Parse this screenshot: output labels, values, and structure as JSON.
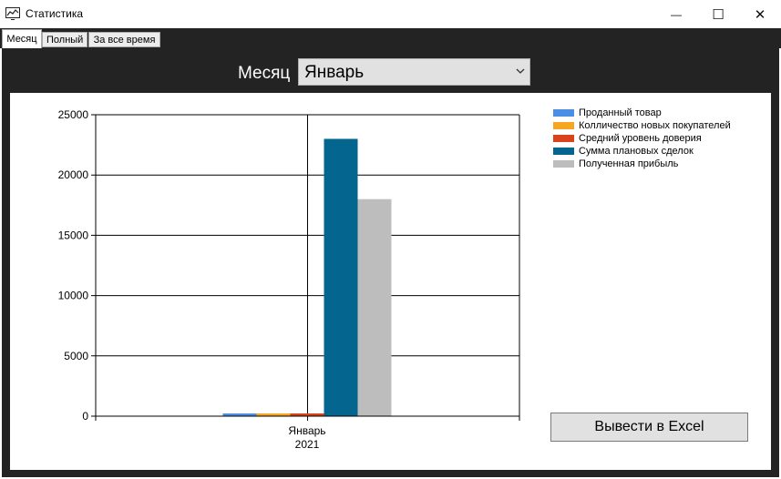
{
  "window": {
    "title": "Статистика",
    "minimize_glyph": "—",
    "maximize_glyph": "☐",
    "close_glyph": "✕"
  },
  "tabs": [
    {
      "label": "Месяц",
      "active": true
    },
    {
      "label": "Полный",
      "active": false
    },
    {
      "label": "За все время",
      "active": false
    }
  ],
  "filter": {
    "label": "Месяц",
    "selected": "Январь"
  },
  "export_button": "Вывести в Excel",
  "colors": {
    "panel_bg": "#232323",
    "series": [
      "#4a8fe5",
      "#f5a623",
      "#d9421a",
      "#04668f",
      "#bdbdbd"
    ]
  },
  "chart_data": {
    "type": "bar",
    "categories": [
      "Январь\n2021"
    ],
    "series": [
      {
        "name": "Проданный товар",
        "values": [
          150
        ],
        "color": "#4a8fe5"
      },
      {
        "name": "Колличество новых покупателей",
        "values": [
          150
        ],
        "color": "#f5a623"
      },
      {
        "name": "Средний уровень доверия",
        "values": [
          150
        ],
        "color": "#d9421a"
      },
      {
        "name": "Сумма плановых сделок",
        "values": [
          23000
        ],
        "color": "#04668f"
      },
      {
        "name": "Полученная прибыль",
        "values": [
          18000
        ],
        "color": "#bdbdbd"
      }
    ],
    "yticks": [
      "25000",
      "20000",
      "15000",
      "10000",
      "5000",
      "0"
    ],
    "ylim": [
      0,
      25000
    ],
    "x_tick_line1": "Январь",
    "x_tick_line2": "2021",
    "grid": true,
    "legend_position": "top-right"
  }
}
